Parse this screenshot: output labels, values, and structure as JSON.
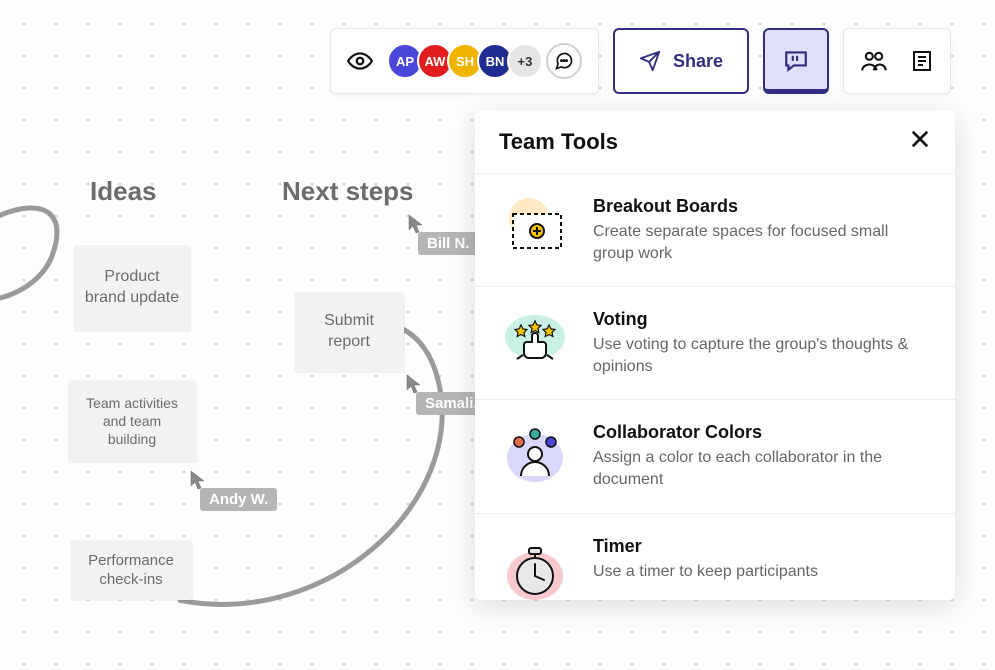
{
  "toolbar": {
    "avatars": [
      {
        "initials": "AP",
        "color": "#4a46d9"
      },
      {
        "initials": "AW",
        "color": "#e11d1d"
      },
      {
        "initials": "SH",
        "color": "#f0b400"
      },
      {
        "initials": "BN",
        "color": "#1e2d8f"
      }
    ],
    "more_label": "+3",
    "share_label": "Share"
  },
  "canvas": {
    "sections": [
      {
        "id": "ideas",
        "title": "Ideas"
      },
      {
        "id": "next",
        "title": "Next steps"
      }
    ],
    "cards": [
      {
        "id": "c1",
        "text": "Product brand update"
      },
      {
        "id": "c2",
        "text": "Team activities and team building"
      },
      {
        "id": "c3",
        "text": "Performance check-ins"
      },
      {
        "id": "c4",
        "text": "Submit report"
      }
    ],
    "cursors": [
      {
        "id": "u1",
        "label": "Bill N."
      },
      {
        "id": "u2",
        "label": "Samali..."
      },
      {
        "id": "u3",
        "label": "Andy W."
      }
    ]
  },
  "panel": {
    "title": "Team Tools",
    "items": [
      {
        "id": "breakout",
        "title": "Breakout Boards",
        "desc": "Create separate spaces for focused small group work"
      },
      {
        "id": "voting",
        "title": "Voting",
        "desc": "Use voting to capture the group's thoughts & opinions"
      },
      {
        "id": "colors",
        "title": "Collaborator Colors",
        "desc": "Assign a color to each collaborator in the document"
      },
      {
        "id": "timer",
        "title": "Timer",
        "desc": "Use a timer to keep participants"
      }
    ]
  }
}
